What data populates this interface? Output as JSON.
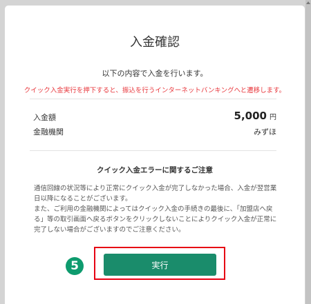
{
  "background": {
    "fragments": [
      "…",
      "…"
    ]
  },
  "modal": {
    "title": "入金確認",
    "intro": "以下の内容で入金を行います。",
    "warning": "クイック入金実行を押下すると、振込を行うインターネットバンキングへと遷移します。",
    "rows": [
      {
        "label": "入金額",
        "value": "5,000",
        "unit": "円"
      },
      {
        "label": "金融機関",
        "value": "みずほ"
      }
    ],
    "notice": {
      "heading": "クイック入金エラーに関するご注意",
      "paragraphs": [
        "通信回線の状況等により正常にクイック入金が完了しなかった場合、入金が翌営業日以降になることがございます。",
        "また、ご利用の金融機関によってはクイック入金の手続きの最後に、「加盟店へ戻る」等の取引画面へ戻るボタンをクリックしないことによりクイック入金が正常に完了しない場合がございますのでご注意ください。"
      ]
    },
    "execute_button": "実行"
  },
  "annotation": {
    "step_number": "5",
    "highlight_color": "#e60012",
    "badge_color": "#0e9b6e"
  },
  "colors": {
    "button": "#1a8c6b",
    "warning": "#e8383d"
  }
}
